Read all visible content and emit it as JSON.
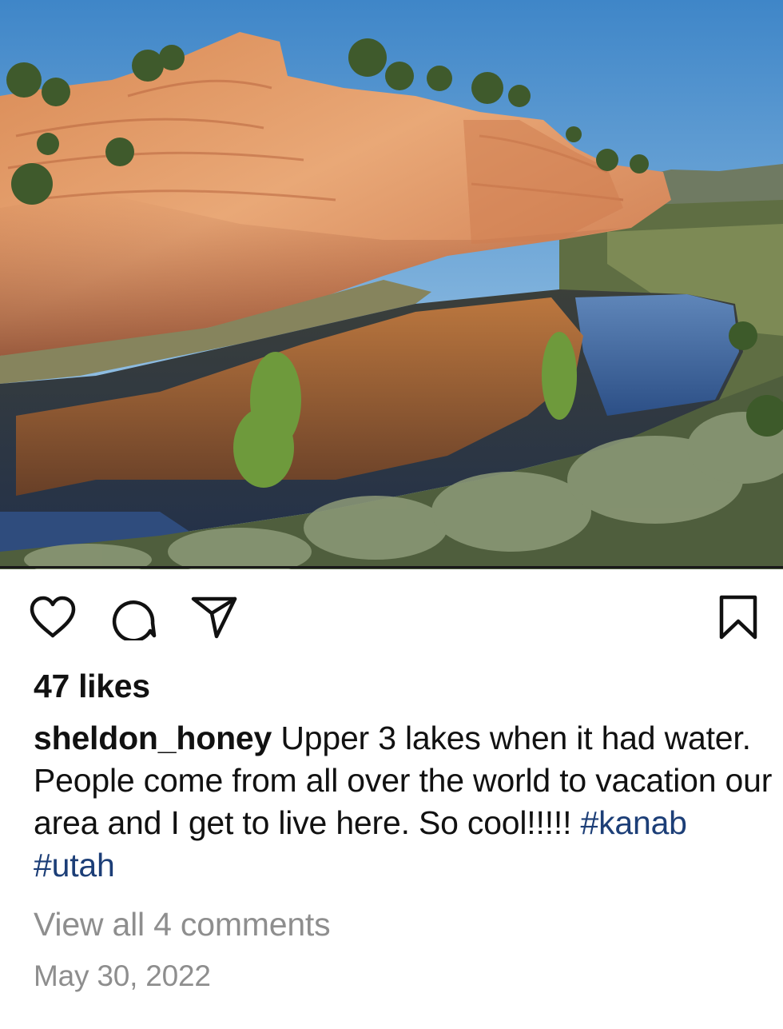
{
  "post": {
    "photo": {
      "alt": "Red sandstone cliff reflected in a lake"
    },
    "actions": {
      "like_icon": "heart-icon",
      "comment_icon": "speech-bubble-icon",
      "share_icon": "paper-plane-icon",
      "save_icon": "bookmark-icon"
    },
    "likes": "47 likes",
    "username": "sheldon_honey",
    "caption_text": "Upper 3 lakes when it had water. People come from all over the world to vacation our area and I get to live here.  So cool!!!!!",
    "hashtags": [
      "#kanab",
      "#utah"
    ],
    "view_comments": "View all 4 comments",
    "date": "May 30, 2022"
  },
  "colors": {
    "hashtag": "#1c3e77",
    "muted": "#8e8e8e",
    "text": "#111111"
  }
}
